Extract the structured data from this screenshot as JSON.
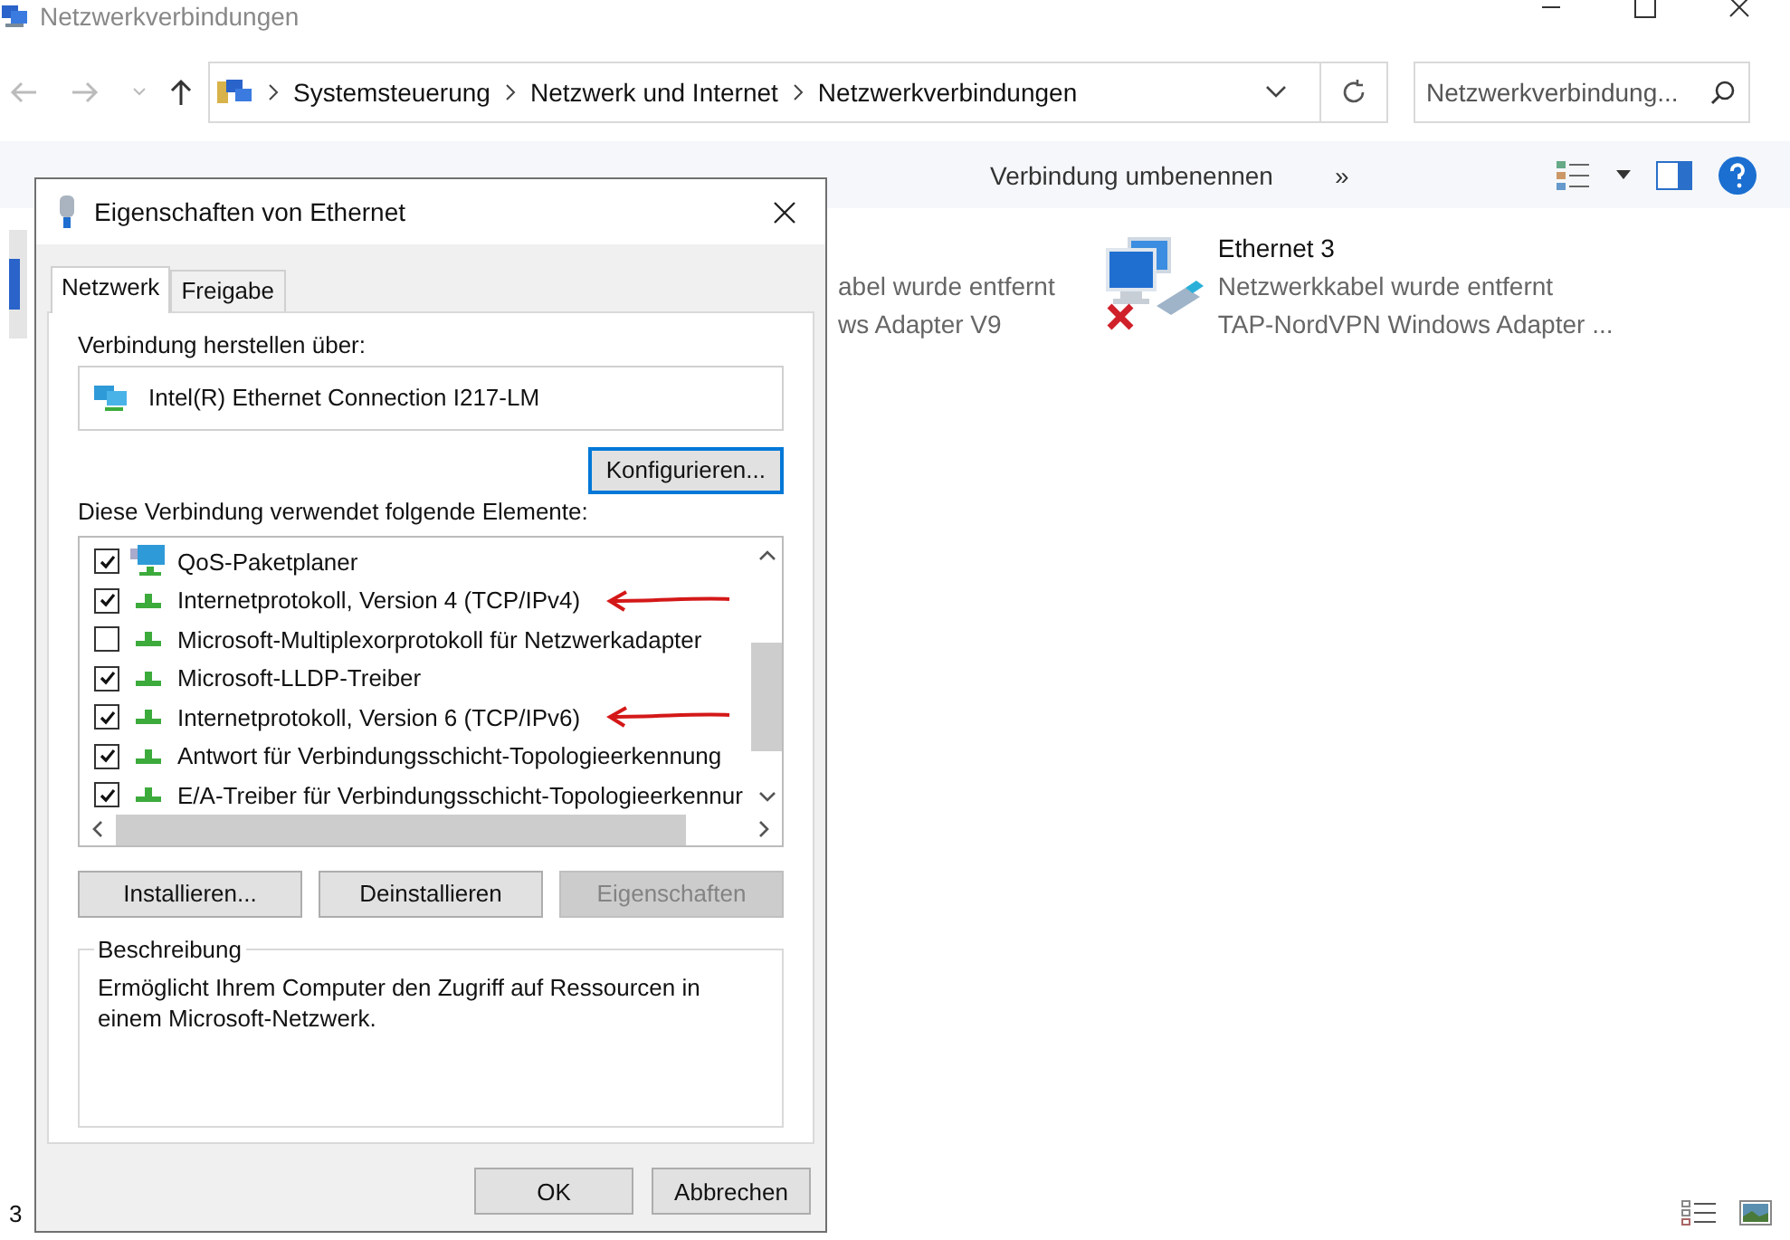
{
  "window": {
    "title": "Netzwerkverbindungen"
  },
  "address": {
    "segments": [
      "Systemsteuerung",
      "Netzwerk und Internet",
      "Netzwerkverbindungen"
    ]
  },
  "search": {
    "placeholder": "Netzwerkverbindung..."
  },
  "toolbar": {
    "items": [
      "Verbindung umbenennen",
      "»"
    ]
  },
  "connections": [
    {
      "status": "abel wurde entfernt",
      "adapter": "ws Adapter V9"
    },
    {
      "name": "Ethernet 3",
      "status": "Netzwerkkabel wurde entfernt",
      "adapter": "TAP-NordVPN Windows Adapter ...",
      "disconnected": true
    }
  ],
  "status_bar": {
    "count": "3"
  },
  "dialog": {
    "title": "Eigenschaften von Ethernet",
    "tabs": [
      {
        "label": "Netzwerk",
        "selected": true
      },
      {
        "label": "Freigabe",
        "selected": false
      }
    ],
    "connect_label": "Verbindung herstellen über:",
    "adapter": "Intel(R) Ethernet Connection I217-LM",
    "configure_button": "Konfigurieren...",
    "elements_label": "Diese Verbindung verwendet folgende Elemente:",
    "elements": [
      {
        "kind": "service",
        "label": "QoS-Paketplaner",
        "checked": true,
        "annotated": false
      },
      {
        "kind": "protocol",
        "label": "Internetprotokoll, Version 4 (TCP/IPv4)",
        "checked": true,
        "annotated": true
      },
      {
        "kind": "protocol",
        "label": "Microsoft-Multiplexorprotokoll für Netzwerkadapter",
        "checked": false,
        "annotated": false
      },
      {
        "kind": "protocol",
        "label": "Microsoft-LLDP-Treiber",
        "checked": true,
        "annotated": false
      },
      {
        "kind": "protocol",
        "label": "Internetprotokoll, Version 6 (TCP/IPv6)",
        "checked": true,
        "annotated": true
      },
      {
        "kind": "protocol",
        "label": "Antwort für Verbindungsschicht-Topologieerkennung",
        "checked": true,
        "annotated": false
      },
      {
        "kind": "protocol",
        "label": "E/A-Treiber für Verbindungsschicht-Topologieerkennur",
        "checked": true,
        "annotated": false
      }
    ],
    "buttons": [
      {
        "label": "Installieren...",
        "disabled": false
      },
      {
        "label": "Deinstallieren",
        "disabled": false
      },
      {
        "label": "Eigenschaften",
        "disabled": true
      }
    ],
    "description_title": "Beschreibung",
    "description": "Ermöglicht Ihrem Computer den Zugriff auf Ressourcen in einem Microsoft-Netzwerk.",
    "footer_buttons": [
      "OK",
      "Abbrechen"
    ]
  }
}
